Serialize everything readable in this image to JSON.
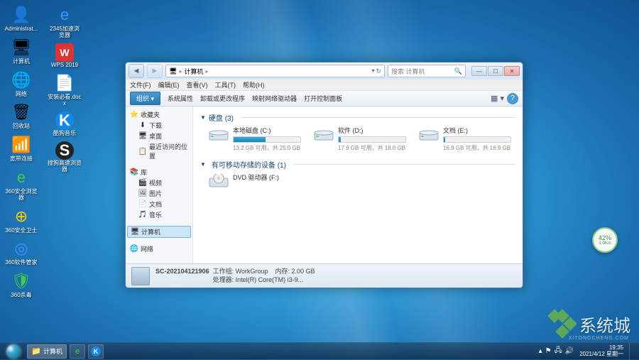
{
  "desktop_icons": [
    {
      "label": "Administrat...",
      "glyph": "👤"
    },
    {
      "label": "计算机",
      "glyph": "🖥"
    },
    {
      "label": "网络",
      "glyph": "🌐"
    },
    {
      "label": "回收站",
      "glyph": "🗑"
    },
    {
      "label": "宽带连接",
      "glyph": "📶"
    },
    {
      "label": "360安全浏览器",
      "glyph": "e"
    },
    {
      "label": "360安全卫士",
      "glyph": "⊕"
    },
    {
      "label": "360软件管家",
      "glyph": "◎"
    },
    {
      "label": "360杀毒",
      "glyph": "🛡"
    },
    {
      "label": "2345加速浏览器",
      "glyph": "e"
    },
    {
      "label": "WPS 2019",
      "glyph": "W"
    },
    {
      "label": "安装必看.docx",
      "glyph": "📄"
    },
    {
      "label": "酷狗音乐",
      "glyph": "K"
    },
    {
      "label": "搜狗高速浏览器",
      "glyph": "S"
    }
  ],
  "window": {
    "address": {
      "root": "计算机",
      "arrow": "▸"
    },
    "search_placeholder": "搜索 计算机",
    "menu": [
      "文件(F)",
      "编辑(E)",
      "查看(V)",
      "工具(T)",
      "帮助(H)"
    ],
    "toolbar": {
      "organize": "组织 ▾",
      "items": [
        "系统属性",
        "卸载或更改程序",
        "映射网络驱动器",
        "打开控制面板"
      ]
    },
    "sidebar": {
      "favorites": {
        "label": "收藏夹",
        "children": [
          "下载",
          "桌面",
          "最近访问的位置"
        ]
      },
      "libraries": {
        "label": "库",
        "children": [
          "视频",
          "图片",
          "文档",
          "音乐"
        ]
      },
      "computer": {
        "label": "计算机"
      },
      "network": {
        "label": "网络"
      }
    },
    "content": {
      "hdd_header": "硬盘 (3)",
      "removable_header": "有可移动存储的设备 (1)",
      "drives": [
        {
          "name": "本地磁盘 (C:)",
          "sub": "13.2 GB 可用，共 25.0 GB",
          "fill": 48
        },
        {
          "name": "软件 (D:)",
          "sub": "17.9 GB 可用，共 18.0 GB",
          "fill": 3
        },
        {
          "name": "文档 (E:)",
          "sub": "16.9 GB 可用，共 16.9 GB",
          "fill": 2
        }
      ],
      "dvd": {
        "name": "DVD 驱动器 (F:)"
      }
    },
    "status": {
      "name": "SC-202104121906",
      "workgroup_label": "工作组:",
      "workgroup": "WorkGroup",
      "mem_label": "内存:",
      "mem": "2.00 GB",
      "cpu_label": "处理器:",
      "cpu": "Intel(R) Core(TM) i3-9..."
    }
  },
  "widget": {
    "main": "42%",
    "sub": "1.0K/s"
  },
  "watermark": {
    "text": "系统城",
    "sub": "XITONGCHENG.COM"
  },
  "taskbar": {
    "app": "计算机",
    "time": "19:35",
    "date": "2021/4/12 星期一"
  }
}
